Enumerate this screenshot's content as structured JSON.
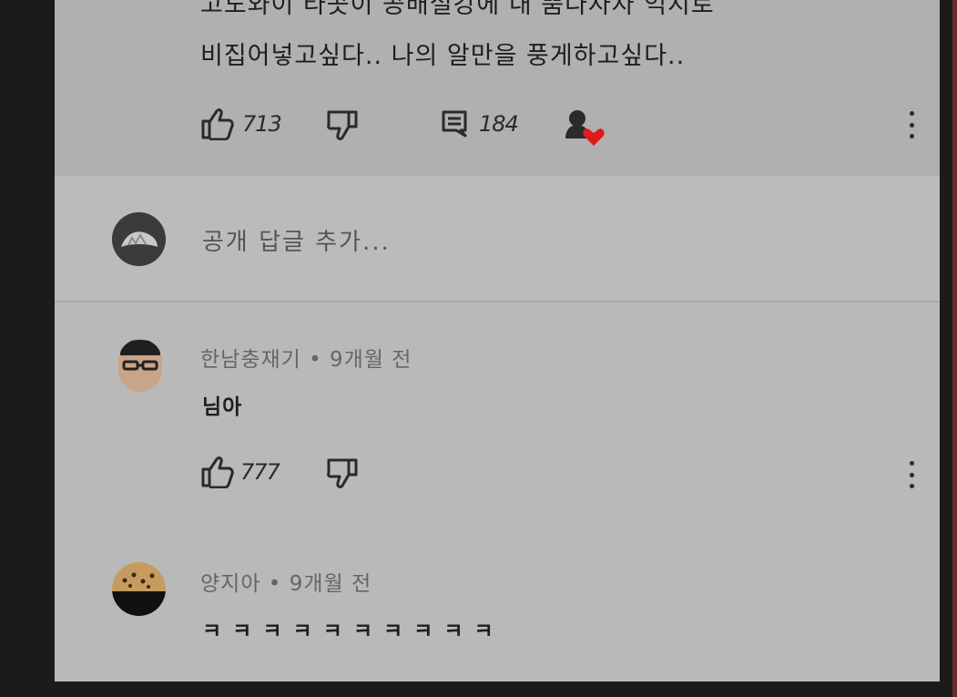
{
  "top_comment": {
    "line1": "고도와이 타곳이 공배설강에 내 뿜다자자 억지로",
    "line2": "비집어넣고싶다.. 나의 알만을 풍게하고싶다..",
    "likes": "713",
    "replies": "184"
  },
  "reply_box": {
    "placeholder": "공개 답글 추가..."
  },
  "comments": [
    {
      "author": "한남충재기",
      "separator": "•",
      "time": "9개월 전",
      "text": "님아",
      "likes": "777"
    },
    {
      "author": "양지아",
      "separator": "•",
      "time": "9개월 전",
      "text": "ㅋ ㅋ ㅋ ㅋ ㅋ ㅋ ㅋ ㅋ ㅋ ㅋ"
    }
  ],
  "colors": {
    "heart": "#e01b1b",
    "panel": "#b9b9b9",
    "background": "#1b1b1b"
  },
  "icons": [
    "thumbs-up-icon",
    "thumbs-down-icon",
    "comment-icon",
    "creator-heart-icon",
    "more-vert-icon"
  ]
}
